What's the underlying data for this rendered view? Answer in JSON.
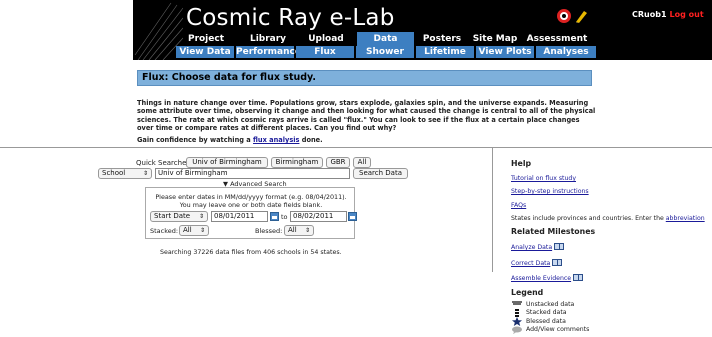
{
  "header": {
    "site_title": "Cosmic Ray e-Lab",
    "user": "CRuob1",
    "logout": "Log out",
    "nav_top": [
      "Project Map",
      "Library",
      "Upload",
      "Data",
      "Posters",
      "Site Map",
      "Assessment"
    ],
    "nav_sub": [
      "View Data",
      "Performance",
      "Flux",
      "Shower",
      "Lifetime",
      "View Plots",
      "Analyses"
    ],
    "active_color": "#3d7fc1"
  },
  "banner": {
    "title": "Flux: Choose data for flux study."
  },
  "intro": {
    "text": "Things in nature change over time. Populations grow, stars explode, galaxies spin, and the universe expands. Measuring some attribute over time, observing it change and then looking for what caused the change is central to all of the physical sciences. The rate at which cosmic rays arrive is called \"flux.\" You can look to see if the flux at a certain place changes over time or compare rates at different places. Can you find out why?",
    "gain_prefix": "Gain confidence by watching a ",
    "gain_link": "flux analysis",
    "gain_suffix": " done."
  },
  "search": {
    "quick_label": "Quick Searches:",
    "quick_buttons": [
      "Univ of Birmingham",
      "Birmingham",
      "GBR",
      "All"
    ],
    "field_select": "School",
    "query_value": "Univ of Birmingham",
    "search_button": "Search Data",
    "advanced_label": "▼ Advanced Search",
    "date_help_1": "Please enter dates in MM/dd/yyyy format (e.g. 08/04/2011).",
    "date_help_2": "You may leave one or both date fields blank.",
    "date_type": "Start Date",
    "date_from": "08/01/2011",
    "to_label": "to",
    "date_to": "08/02/2011",
    "stacked_label": "Stacked:",
    "stacked_value": "All",
    "blessed_label": "Blessed:",
    "blessed_value": "All",
    "status": "Searching 37226 data files from 406 schools in 54 states."
  },
  "sidebar": {
    "help_title": "Help",
    "links": [
      "Tutorial on flux study",
      "Step-by-step instructions",
      "FAQs"
    ],
    "states_text": "States include provinces and countries. Enter the ",
    "states_link": "abbreviation",
    "milestones_title": "Related Milestones",
    "milestones": [
      "Analyze Data",
      "Correct Data",
      "Assemble Evidence"
    ],
    "legend_title": "Legend",
    "legend": [
      {
        "icon": "unstacked-icon",
        "label": "Unstacked data"
      },
      {
        "icon": "stacked-icon",
        "label": "Stacked data"
      },
      {
        "icon": "star-icon",
        "label": "Blessed data"
      },
      {
        "icon": "comment-icon",
        "label": "Add/View comments"
      }
    ]
  }
}
